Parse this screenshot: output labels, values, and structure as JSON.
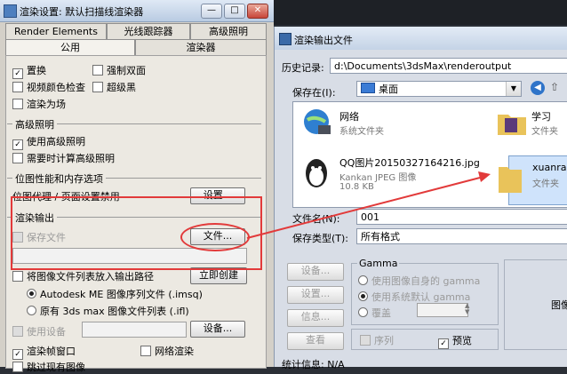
{
  "left_window": {
    "title": "渲染设置: 默认扫描线渲染器",
    "controls": {
      "minimize": "—",
      "restore": "□",
      "close": "✕"
    },
    "tabs_row1": [
      "Render Elements",
      "光线跟踪器",
      "高级照明"
    ],
    "tabs_row2": [
      "公用",
      "渲染器"
    ],
    "checks": {
      "displacement": "置换",
      "force_2side": "强制双面",
      "video_color": "视频颜色检查",
      "super_black": "超级黑",
      "render_fields": "渲染为场"
    },
    "advanced_lighting": {
      "group": "高级照明",
      "use": "使用高级照明",
      "compute": "需要时计算高级照明"
    },
    "bitmap": {
      "group": "位图性能和内存选项",
      "text": "位图代理 / 页面设置禁用",
      "settings_btn": "设置..."
    },
    "render_output": {
      "group": "渲染输出",
      "save_file": "保存文件",
      "files_btn": "文件..."
    },
    "image_list": {
      "put": "将图像文件列表放入输出路径",
      "create_now": "立即创建",
      "autodesk": "Autodesk ME 图像序列文件 (.imsq)",
      "legacy": "原有 3ds max 图像文件列表 (.ifl)"
    },
    "device": {
      "use": "使用设备",
      "btn": "设备..."
    },
    "frame": {
      "render_window": "渲染帧窗口",
      "net_render": "网络渲染"
    },
    "skip": "跳过现有图像"
  },
  "file_dialog": {
    "title": "渲染输出文件",
    "history_label": "历史记录:",
    "history_value": "d:\\Documents\\3dsMax\\renderoutput",
    "savein_label": "保存在(I):",
    "savein_value": "桌面",
    "files": [
      {
        "name": "网络",
        "sub": "系统文件夹"
      },
      {
        "name": "学习",
        "sub": "文件夹"
      },
      {
        "name": "QQ图片20150327164216.jpg",
        "sub": "Kankan JPEG 图像",
        "size": "10.8 KB"
      },
      {
        "name": "xuanrar",
        "sub": "文件夹"
      }
    ],
    "filename_label": "文件名(N):",
    "filename_value": "001",
    "filetype_label": "保存类型(T):",
    "filetype_value": "所有格式",
    "buttons": [
      "设备...",
      "设置...",
      "信息...",
      "查看"
    ],
    "gamma": {
      "group": "Gamma",
      "own": "使用图像自身的 gamma",
      "system": "使用系统默认 gamma",
      "override": "覆盖"
    },
    "sequence": "序列",
    "preview": "预览",
    "stats": "统计信息: N/A",
    "image_label": "图像"
  },
  "colors": {
    "annotation": "#e23a3a",
    "arrow": "#e23a3a"
  }
}
